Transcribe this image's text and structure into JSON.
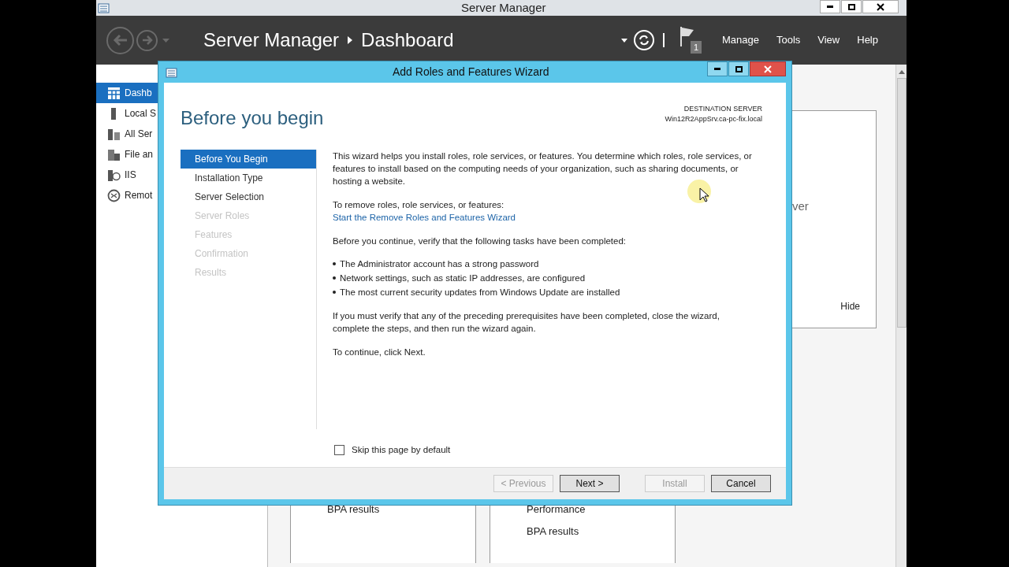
{
  "window": {
    "title": "Server Manager"
  },
  "header": {
    "breadcrumb": [
      "Server Manager",
      "Dashboard"
    ],
    "notification_count": "1",
    "menus": [
      "Manage",
      "Tools",
      "View",
      "Help"
    ]
  },
  "sidebar": {
    "items": [
      {
        "label": "Dashb",
        "kind": "dashboard",
        "selected": true
      },
      {
        "label": "Local S",
        "kind": "server",
        "selected": false
      },
      {
        "label": "All Ser",
        "kind": "servers",
        "selected": false
      },
      {
        "label": "File an",
        "kind": "files",
        "selected": false
      },
      {
        "label": "IIS",
        "kind": "iis",
        "selected": false
      },
      {
        "label": "Remot",
        "kind": "remote",
        "selected": false
      }
    ]
  },
  "background": {
    "side_card": {
      "text": "ver",
      "link": "Hide"
    },
    "tiles": [
      {
        "lines": [
          "BPA results"
        ]
      },
      {
        "lines": [
          "Performance",
          "BPA results"
        ]
      }
    ]
  },
  "wizard": {
    "title": "Add Roles and Features Wizard",
    "heading": "Before you begin",
    "destination": {
      "label": "DESTINATION SERVER",
      "server": "Win12R2AppSrv.ca-pc-fix.local"
    },
    "steps": [
      {
        "label": "Before You Begin",
        "selected": true,
        "disabled": false
      },
      {
        "label": "Installation Type",
        "selected": false,
        "disabled": false
      },
      {
        "label": "Server Selection",
        "selected": false,
        "disabled": false
      },
      {
        "label": "Server Roles",
        "selected": false,
        "disabled": true
      },
      {
        "label": "Features",
        "selected": false,
        "disabled": true
      },
      {
        "label": "Confirmation",
        "selected": false,
        "disabled": true
      },
      {
        "label": "Results",
        "selected": false,
        "disabled": true
      }
    ],
    "content": [
      {
        "kind": "paragraph",
        "text": "This wizard helps you install roles, role services, or features. You determine which roles, role services, or features to install based on the computing needs of your organization, such as sharing documents, or hosting a website."
      },
      {
        "kind": "paragraph",
        "text": "To remove roles, role services, or features:",
        "link": "Start the Remove Roles and Features Wizard"
      },
      {
        "kind": "paragraph",
        "text": "Before you continue, verify that the following tasks have been completed:"
      },
      {
        "kind": "bullets",
        "items": [
          "The Administrator account has a strong password",
          "Network settings, such as static IP addresses, are configured",
          "The most current security updates from Windows Update are installed"
        ]
      },
      {
        "kind": "paragraph",
        "text": "If you must verify that any of the preceding prerequisites have been completed, close the wizard, complete the steps, and then run the wizard again."
      },
      {
        "kind": "paragraph",
        "text": "To continue, click Next."
      }
    ],
    "skip_checkbox": {
      "label": "Skip this page by default",
      "checked": false
    },
    "buttons": [
      {
        "label": "< Previous",
        "disabled": true
      },
      {
        "label": "Next >",
        "disabled": false
      },
      {
        "label": "Install",
        "disabled": true
      },
      {
        "label": "Cancel",
        "disabled": false
      }
    ]
  }
}
